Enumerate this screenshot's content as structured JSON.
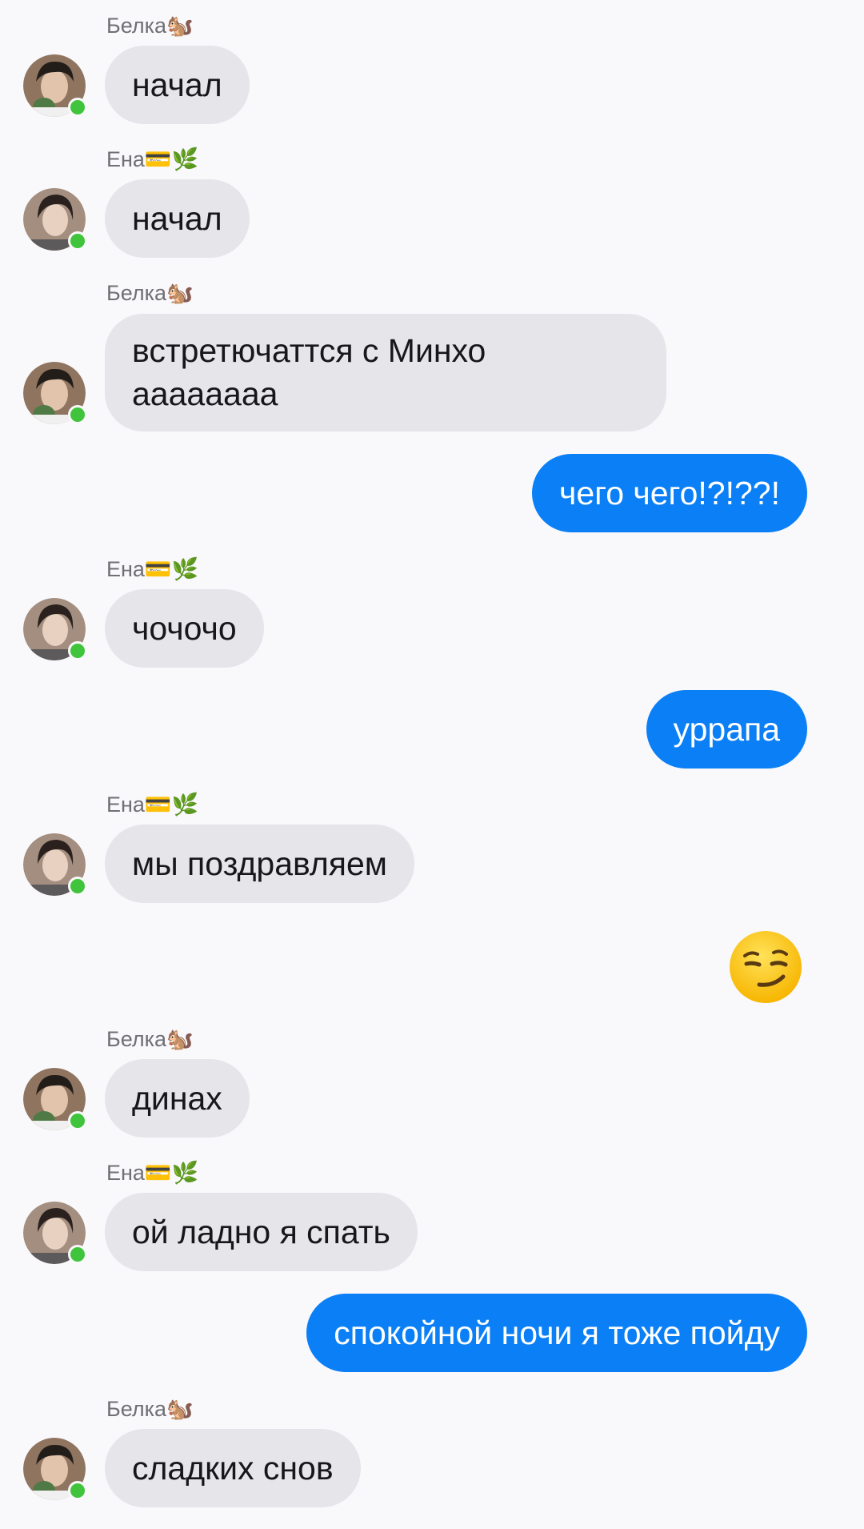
{
  "messages": [
    {
      "sender": "Белка🐿️",
      "text": "начал"
    },
    {
      "sender": "Ена💳🌿",
      "text": "начал"
    },
    {
      "sender": "Белка🐿️",
      "line1": "встретючаттся с Минхо",
      "line2": "аааааааа"
    },
    {
      "text": "чего чего!?!??!"
    },
    {
      "sender": "Ена💳🌿",
      "text": "чочочо"
    },
    {
      "text": "уррапа"
    },
    {
      "sender": "Ена💳🌿",
      "text": "мы поздравляем"
    },
    {
      "emoji": "smirking-face"
    },
    {
      "sender": "Белка🐿️",
      "text": "динах"
    },
    {
      "sender": "Ена💳🌿",
      "text": "ой ладно я спать"
    },
    {
      "text": "спокойной ночи я тоже пойду"
    },
    {
      "sender": "Белка🐿️",
      "text": "сладких снов"
    }
  ],
  "colors": {
    "background": "#f9f8fb",
    "incoming_bubble": "#e6e5ea",
    "outgoing_bubble": "#0b7ff6",
    "online_indicator": "#3fc43b"
  }
}
